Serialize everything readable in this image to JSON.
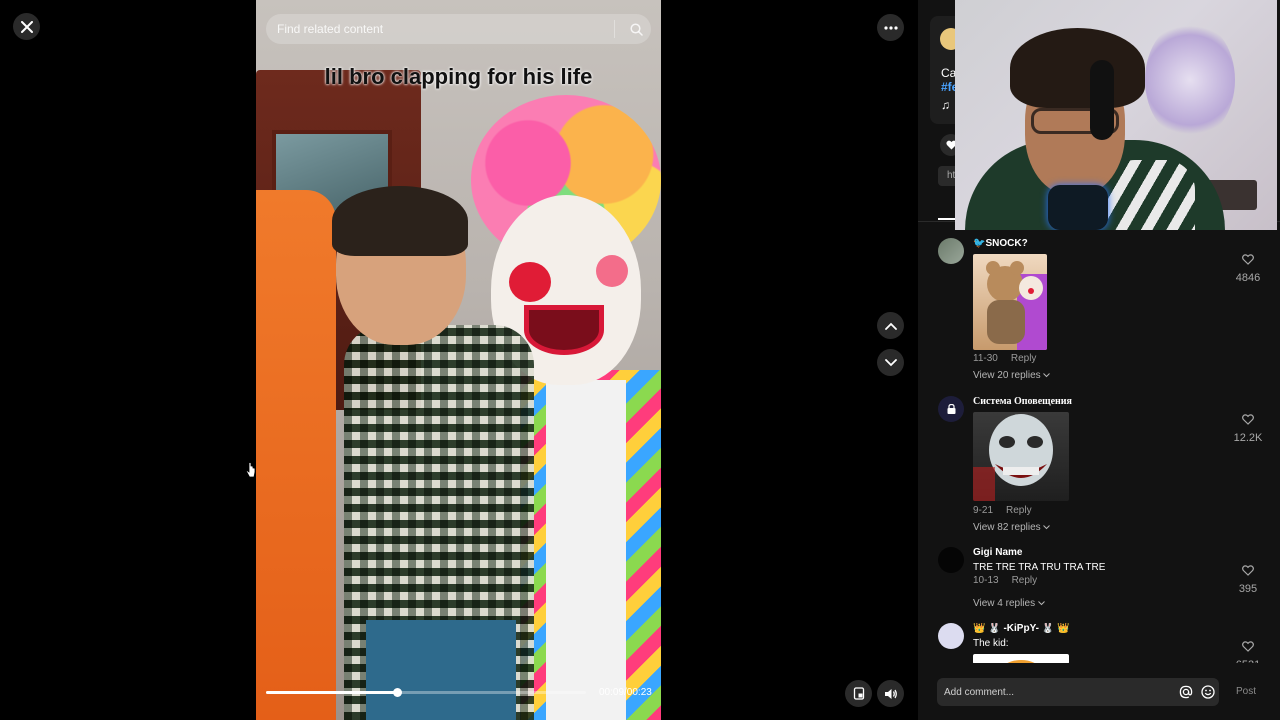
{
  "icons": {
    "close": "close-icon",
    "more": "more-dots-icon",
    "search": "search-icon",
    "up": "chevron-up-icon",
    "down": "chevron-down-icon",
    "pip": "floating-player-icon",
    "volume": "volume-icon",
    "like": "heart-icon",
    "mention": "at-icon",
    "emoji": "emoji-icon",
    "music": "music-note-icon"
  },
  "video": {
    "search_placeholder": "Find related content",
    "caption": "lil bro clapping for his life",
    "time": "00:09/00:23",
    "progress": 0.41
  },
  "post": {
    "desc_fragment": "Ca",
    "tag_fragment": "#fe",
    "music_fragment": "♫",
    "link_fragment": "ht"
  },
  "comments": [
    {
      "name": "🐦SNOCK?",
      "text": "",
      "has_media": true,
      "date": "11-30",
      "reply": "Reply",
      "view_replies": "View 20 replies",
      "likes": "4846"
    },
    {
      "name": "Система Оповещения",
      "text": "",
      "has_media": true,
      "date": "9-21",
      "reply": "Reply",
      "view_replies": "View 82 replies",
      "likes": "12.2K"
    },
    {
      "name": "Gigi Name",
      "text": "TRE TRE TRA TRU TRA TRE",
      "has_media": false,
      "date": "10-13",
      "reply": "Reply",
      "view_replies": "View 4 replies",
      "likes": "395"
    },
    {
      "name": "👑 🐰 -KiPpY- 🐰 👑",
      "text": "The kid:",
      "has_media": true,
      "date": "",
      "reply": "",
      "view_replies": "",
      "likes": "6531"
    }
  ],
  "composer": {
    "placeholder": "Add comment...",
    "post_label": "Post"
  },
  "colors": {
    "panel_bg": "#121212",
    "accent_link": "#4aa3ff",
    "button_bg": "#2a2a2a"
  }
}
